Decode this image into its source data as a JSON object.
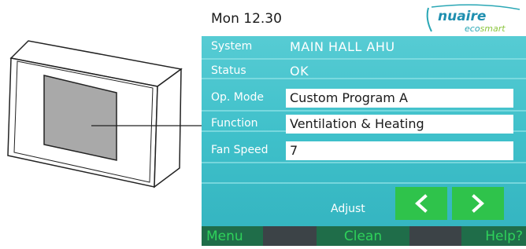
{
  "header": {
    "date": "Mon 12.30"
  },
  "logo": {
    "brand": "nuaire",
    "sub": "ecosmart"
  },
  "rows": [
    {
      "label": "System",
      "value": "MAIN HALL AHU"
    },
    {
      "label": "Status",
      "value": "OK"
    },
    {
      "label": "Op. Mode",
      "value": "Custom Program A"
    },
    {
      "label": "Function",
      "value": "Ventilation & Heating"
    },
    {
      "label": "Fan Speed",
      "value": "7"
    }
  ],
  "adjust": {
    "label": "Adjust"
  },
  "bottom": {
    "menu": "Menu",
    "clean": "Clean",
    "help": "Help?"
  },
  "colors": {
    "panel": "#3fc0ca",
    "green_button": "#2fc34b",
    "bottom_bar": "#3c4347",
    "bottom_button": "#1f6d49",
    "bottom_text": "#2fd25b"
  }
}
